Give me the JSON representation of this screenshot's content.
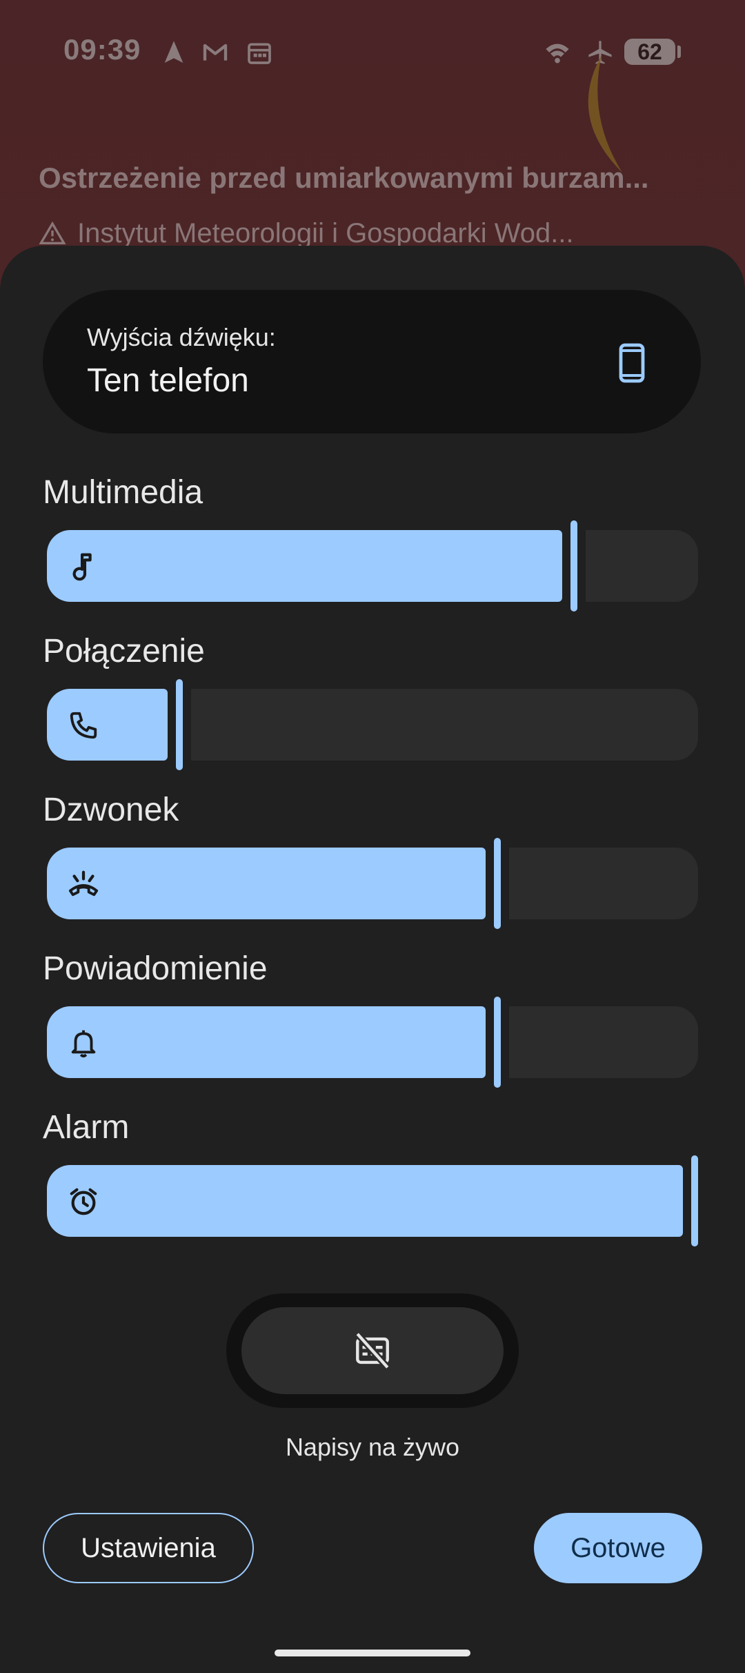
{
  "status_bar": {
    "time": "09:39",
    "battery": "62",
    "icons": [
      "navigation-icon",
      "gmail-icon",
      "calendar-icon",
      "wifi-icon",
      "airplane-mode-icon"
    ]
  },
  "background_notification": {
    "title": "Ostrzeżenie przed umiarkowanymi burzam...",
    "source": "Instytut Meteorologii i Gospodarki Wod..."
  },
  "output": {
    "label": "Wyjścia dźwięku:",
    "value": "Ten telefon",
    "icon": "phone-icon"
  },
  "streams": [
    {
      "label": "Multimedia",
      "level": 0.81,
      "icon": "music-note-icon"
    },
    {
      "label": "Połączenie",
      "level": 0.19,
      "icon": "phone-call-icon"
    },
    {
      "label": "Dzwonek",
      "level": 0.69,
      "icon": "ringer-icon"
    },
    {
      "label": "Powiadomienie",
      "level": 0.69,
      "icon": "bell-icon"
    },
    {
      "label": "Alarm",
      "level": 1.0,
      "icon": "alarm-icon"
    }
  ],
  "live_caption": {
    "label": "Napisy na żywo",
    "icon": "captions-off-icon"
  },
  "buttons": {
    "settings": "Ustawienia",
    "done": "Gotowe"
  },
  "colors": {
    "accent": "#9ccbff",
    "sheet": "#202020",
    "track": "#2c2c2c"
  }
}
